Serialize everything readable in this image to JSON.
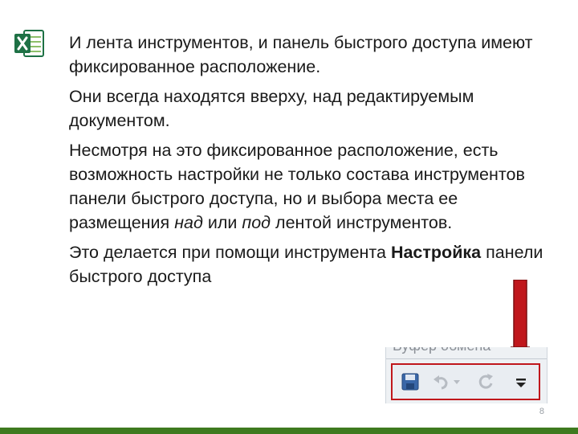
{
  "slide": {
    "paragraphs": [
      {
        "text": "И лента инструментов, и панель быстрого доступа имеют фиксированное расположение."
      },
      {
        "text": "Они всегда находятся вверху, над редактируемым документом."
      },
      {
        "part1": "Несмотря на это фиксированное расположение, есть возможность настройки не только состава инструментов панели быстрого доступа, но и выбора места ее размещения ",
        "italic1": "над",
        "part2": " или ",
        "italic2": "под",
        "part3": " лентой инструментов."
      },
      {
        "part1": "Это делается при помощи инструмента ",
        "bold": "Настройка",
        "part2": " панели быстрого доступа"
      }
    ],
    "page_number": "8"
  },
  "qat_image": {
    "cut_label": "Буфер обмена",
    "icons": [
      "save-icon",
      "undo-icon",
      "dropdown-icon",
      "redo-icon",
      "customize-qat-icon"
    ]
  },
  "colors": {
    "highlight_border": "#c0171c",
    "arrow": "#c0171c",
    "footer_bar": "#3e7a1f",
    "excel_green": "#1e7145"
  }
}
